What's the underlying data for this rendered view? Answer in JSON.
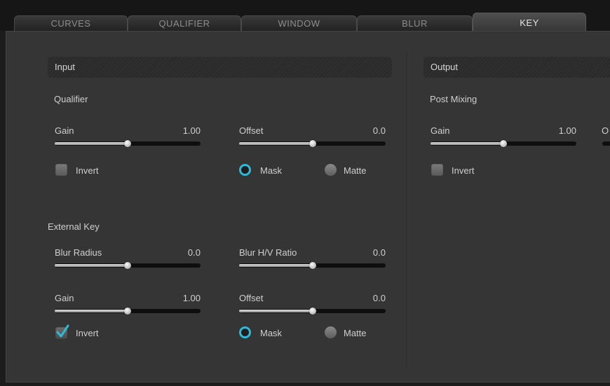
{
  "tabs": [
    {
      "label": "CURVES",
      "active": false
    },
    {
      "label": "QUALIFIER",
      "active": false
    },
    {
      "label": "WINDOW",
      "active": false
    },
    {
      "label": "BLUR",
      "active": false
    },
    {
      "label": "KEY",
      "active": true
    }
  ],
  "input": {
    "header": "Input",
    "qualifier": {
      "title": "Qualifier",
      "gain": {
        "label": "Gain",
        "value": "1.00",
        "level": 0.5
      },
      "offset": {
        "label": "Offset",
        "value": "0.0",
        "level": 0.5
      },
      "invert": {
        "label": "Invert",
        "checked": false
      },
      "mask": {
        "label": "Mask",
        "selected": true
      },
      "matte": {
        "label": "Matte",
        "selected": false
      }
    },
    "external_key": {
      "title": "External Key",
      "blur_radius": {
        "label": "Blur Radius",
        "value": "0.0",
        "level": 0.5
      },
      "blur_hv_ratio": {
        "label": "Blur H/V Ratio",
        "value": "0.0",
        "level": 0.5
      },
      "gain": {
        "label": "Gain",
        "value": "1.00",
        "level": 0.5
      },
      "offset": {
        "label": "Offset",
        "value": "0.0",
        "level": 0.5
      },
      "invert": {
        "label": "Invert",
        "checked": true
      },
      "mask": {
        "label": "Mask",
        "selected": true
      },
      "matte": {
        "label": "Matte",
        "selected": false
      }
    }
  },
  "output": {
    "header": "Output",
    "post_mixing": {
      "title": "Post Mixing",
      "gain": {
        "label": "Gain",
        "value": "1.00",
        "level": 0.5
      },
      "offset_partial": "O",
      "invert": {
        "label": "Invert",
        "checked": false
      }
    }
  },
  "colors": {
    "accent": "#2fb9d8",
    "panel": "#353535",
    "background": "#1c1c1c"
  }
}
